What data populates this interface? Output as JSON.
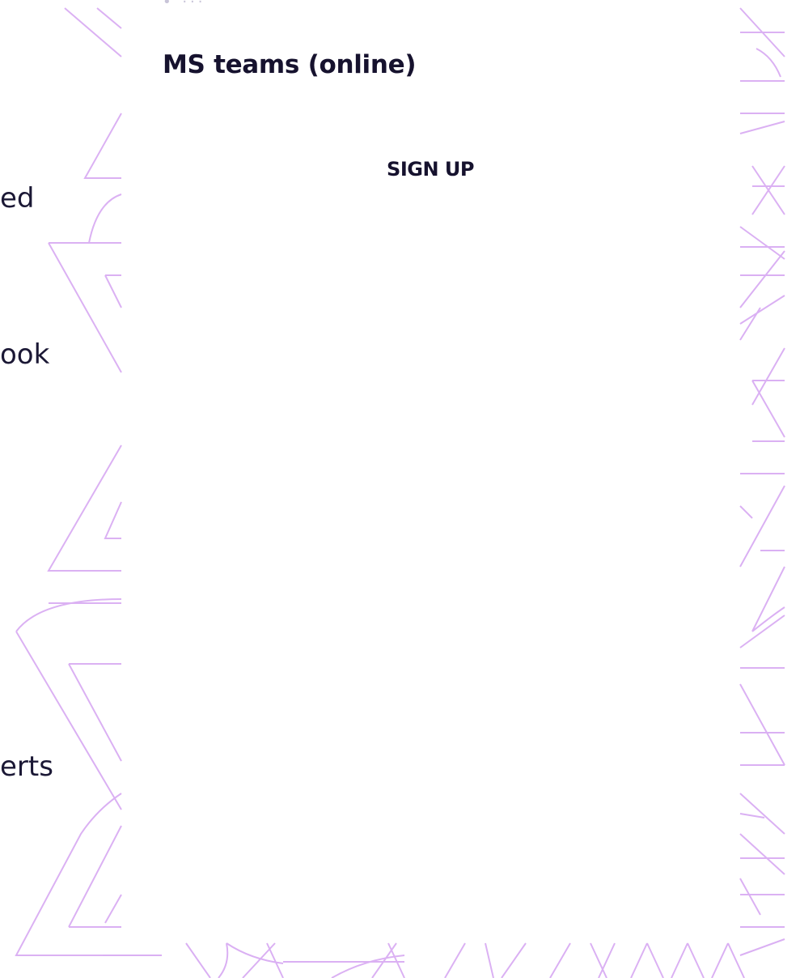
{
  "page": {
    "cutoff_text": "• ···"
  },
  "left_snippets": {
    "line_1": "ed",
    "line_2": "ook",
    "line_3": "erts"
  },
  "card": {
    "title": "MS teams (online)",
    "signup_label": "SIGN UP"
  },
  "colors": {
    "text": "#16122e",
    "pattern_stroke": "#d7a8f2",
    "background": "#ffffff"
  }
}
